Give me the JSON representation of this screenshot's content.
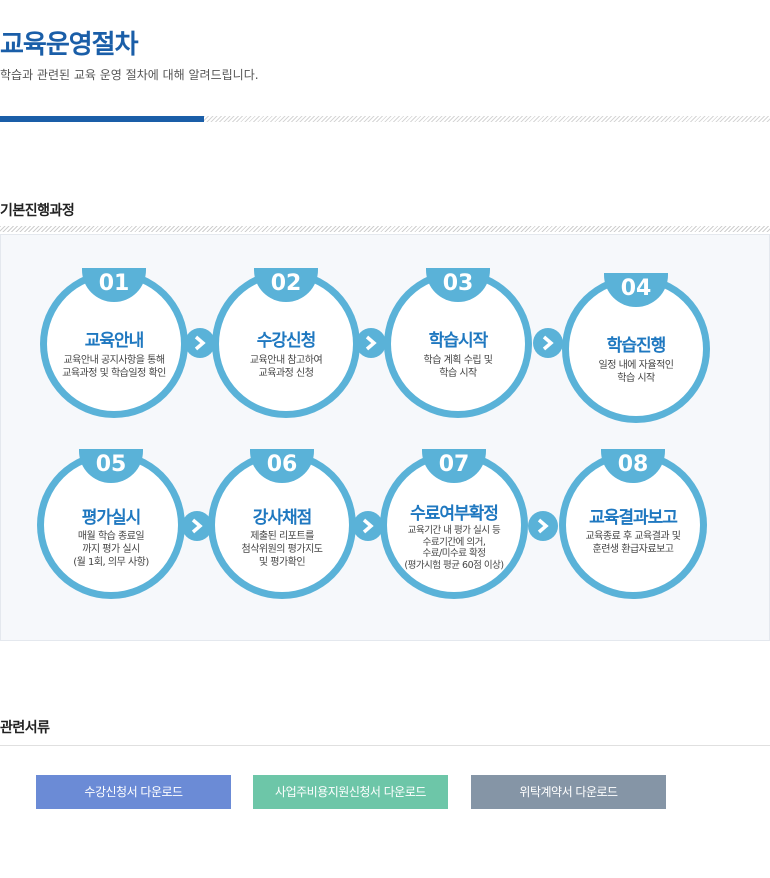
{
  "header": {
    "title": "교육운영절차",
    "subtitle": "학습과 관련된 교육 운영 절차에 대해 알려드립니다."
  },
  "process": {
    "title": "기본진행과정",
    "steps": [
      {
        "num": "01",
        "name": "교육안내",
        "desc": [
          "교육안내 공지사항을 통해",
          "교육과정 및 학습일정 확인"
        ]
      },
      {
        "num": "02",
        "name": "수강신청",
        "desc": [
          "교육안내 참고하여",
          "교육과정 신청"
        ]
      },
      {
        "num": "03",
        "name": "학습시작",
        "desc": [
          "학습 계획 수립 및",
          "학습 시작"
        ]
      },
      {
        "num": "04",
        "name": "학습진행",
        "desc": [
          "일정 내에 자율적인",
          "학습 시작"
        ]
      },
      {
        "num": "05",
        "name": "평가실시",
        "desc": [
          "매월 학습 종료일",
          "까지 평가 실시",
          "(월 1회, 의무 사항)"
        ]
      },
      {
        "num": "06",
        "name": "강사채점",
        "desc": [
          "제출된 리포트를",
          "첨삭위원의 평가지도",
          "및 평가확인"
        ]
      },
      {
        "num": "07",
        "name": "수료여부확정",
        "desc": [
          "교육기간 내 평가 실시 등",
          "수료기간에 의거,",
          "수료/미수료 확정",
          "(평가시험 평균 60점 이상)"
        ]
      },
      {
        "num": "08",
        "name": "교육결과보고",
        "desc": [
          "교육종료 후 교육결과 및",
          "훈련생 환급자료보고"
        ]
      }
    ]
  },
  "documents": {
    "title": "관련서류",
    "buttons": [
      {
        "label": "수강신청서 다운로드",
        "color": "#6b8bd6"
      },
      {
        "label": "사업주비용지원신청서 다운로드",
        "color": "#6dc6a8"
      },
      {
        "label": "위탁계약서 다운로드",
        "color": "#8595a6"
      }
    ]
  },
  "colors": {
    "brand": "#1a5ea8",
    "step": "#5ab2d8",
    "step_text": "#1f78c0"
  }
}
